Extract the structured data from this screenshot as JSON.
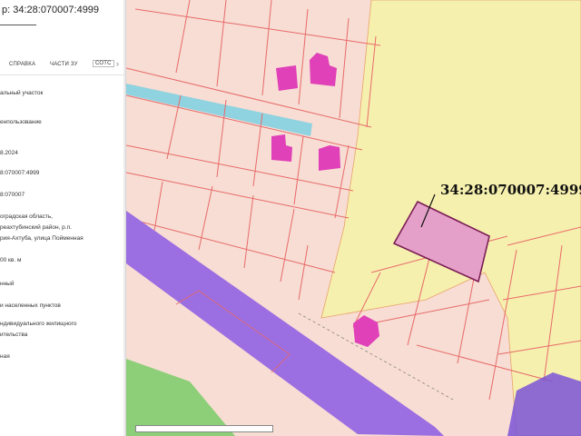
{
  "panel": {
    "title": "р: 34:28:070007:4999",
    "tabs": [
      "сПравка",
      "части зу",
      "сотс"
    ],
    "rows": [
      "альный участок",
      "енпользование",
      "8.2024",
      "8:070007:4999",
      "8:070007",
      "оградская область,",
      "реахтубинский район, р.п.",
      "рия-Ахтуба, улица Пойменная",
      "00 кв. м",
      "нный",
      "и населенных пунктов",
      "ндивидуального жилищного",
      "ительства",
      "ная"
    ]
  },
  "map": {
    "parcel_label": "34:28:070007:4999",
    "colors": {
      "background": "#f7ddd3",
      "territory": "#f6f0ae",
      "parcel_lines": "#e86a6a",
      "selected_parcel_fill": "#e4a0c8",
      "selected_parcel_stroke": "#7a1d55",
      "building": "#e040b8",
      "road": "#9b6ee2",
      "water": "#8fd2e0",
      "vegetation": "#8ccf78"
    }
  }
}
